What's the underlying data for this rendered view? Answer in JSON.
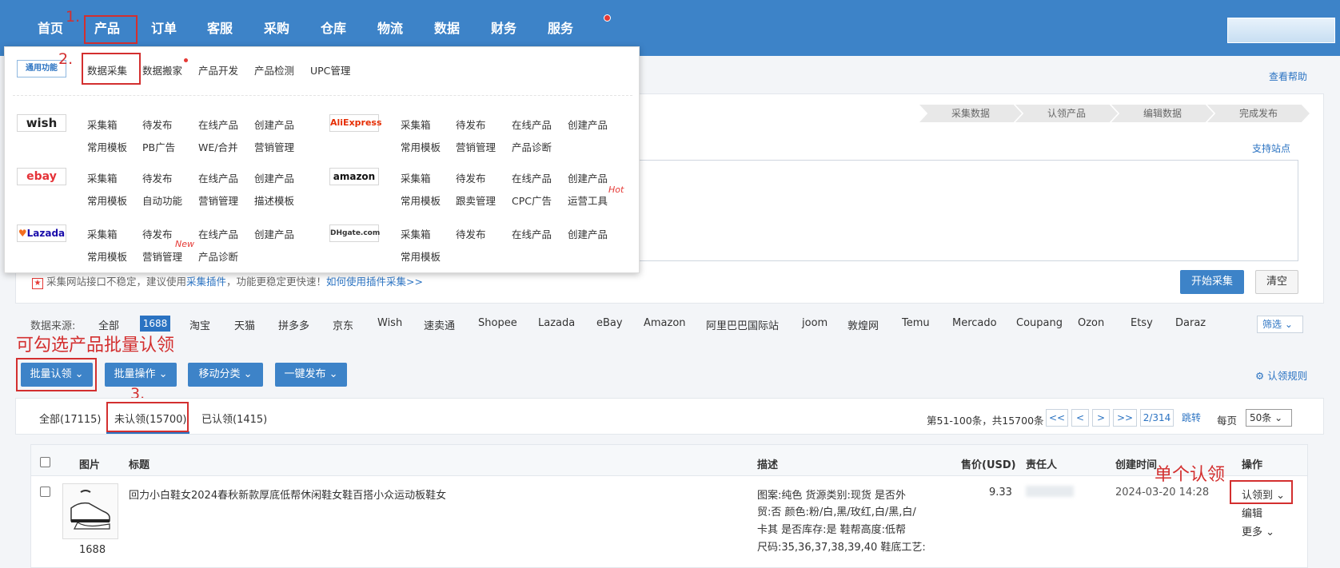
{
  "nav": {
    "items": [
      "首页",
      "产品",
      "订单",
      "客服",
      "采购",
      "仓库",
      "物流",
      "数据",
      "财务",
      "服务"
    ]
  },
  "annotations": {
    "step1": "1.",
    "step2": "2.",
    "step3": "3.",
    "batch_hint": "可勾选产品批量认领",
    "single_hint": "单个认领"
  },
  "dropdown": {
    "general_logo": "通用功能",
    "general_items": [
      "数据采集",
      "数据搬家",
      "产品开发",
      "产品检测",
      "UPC管理"
    ],
    "wish": {
      "logo": "wish",
      "row1": [
        "采集箱",
        "待发布",
        "在线产品",
        "创建产品"
      ],
      "row2": [
        "常用模板",
        "PB广告",
        "WE/合并",
        "营销管理"
      ]
    },
    "aliexpress": {
      "logo": "AliExpress",
      "row1": [
        "采集箱",
        "待发布",
        "在线产品",
        "创建产品"
      ],
      "row2": [
        "常用模板",
        "营销管理",
        "产品诊断"
      ]
    },
    "ebay": {
      "logo": "ebay",
      "row1": [
        "采集箱",
        "待发布",
        "在线产品",
        "创建产品"
      ],
      "row2": [
        "常用模板",
        "自动功能",
        "营销管理",
        "描述模板"
      ]
    },
    "amazon": {
      "logo": "amazon",
      "row1": [
        "采集箱",
        "待发布",
        "在线产品",
        "创建产品"
      ],
      "row2": [
        "常用模板",
        "跟卖管理",
        "CPC广告",
        "运营工具"
      ],
      "tag": "Hot"
    },
    "lazada": {
      "logo": "Lazada",
      "row1": [
        "采集箱",
        "待发布",
        "在线产品",
        "创建产品"
      ],
      "row2": [
        "常用模板",
        "营销管理",
        "产品诊断"
      ],
      "tag": "New"
    },
    "dhgate": {
      "logo": "DHgate.com",
      "row1": [
        "采集箱",
        "待发布",
        "在线产品",
        "创建产品"
      ],
      "row2": [
        "常用模板"
      ]
    }
  },
  "help_link": "查看帮助",
  "steps": [
    "采集数据",
    "认领产品",
    "编辑数据",
    "完成发布"
  ],
  "support_sites": "支持站点",
  "notice": {
    "text": "采集网站接口不稳定，建议使用",
    "plugin": "采集插件",
    "text2": "，功能更稳定更快速！",
    "howto": "如何使用插件采集>>"
  },
  "start_button": "开始采集",
  "clear_button": "清空",
  "sources": {
    "label": "数据来源:",
    "items": [
      "全部",
      "1688",
      "淘宝",
      "天猫",
      "拼多多",
      "京东",
      "Wish",
      "速卖通",
      "Shopee",
      "Lazada",
      "eBay",
      "Amazon",
      "阿里巴巴国际站",
      "joom",
      "敦煌网",
      "Temu",
      "Mercado",
      "Coupang",
      "Ozon",
      "Etsy",
      "Daraz"
    ],
    "filter": "筛选"
  },
  "actions": [
    "批量认领",
    "批量操作",
    "移动分类",
    "一键发布"
  ],
  "claim_rules": "认领规则",
  "tabs": [
    "全部(17115)",
    "未认领(15700)",
    "已认领(1415)"
  ],
  "pager": {
    "summary": "第51-100条，共15700条",
    "first": "<<",
    "prev": "<",
    "next": ">",
    "last": ">>",
    "page": "2/314",
    "jump": "跳转",
    "per_page_label": "每页",
    "per_page": "50条"
  },
  "table": {
    "headers": [
      "图片",
      "标题",
      "描述",
      "售价(USD)",
      "责任人",
      "创建时间",
      "操作"
    ],
    "rows": [
      {
        "source": "1688",
        "title": "回力小白鞋女2024春秋新款厚底低帮休闲鞋女鞋百搭小众运动板鞋女",
        "desc_lines": [
          "图案:纯色 货源类别:现货 是否外",
          "贸:否 颜色:粉/白,黑/玫红,白/黑,白/",
          "卡其 是否库存:是 鞋帮高度:低帮",
          "尺码:35,36,37,38,39,40 鞋底工艺:"
        ],
        "price": "9.33",
        "created": "2024-03-20 14:28",
        "op_claim": "认领到",
        "op_edit": "编辑",
        "op_more": "更多"
      }
    ]
  }
}
